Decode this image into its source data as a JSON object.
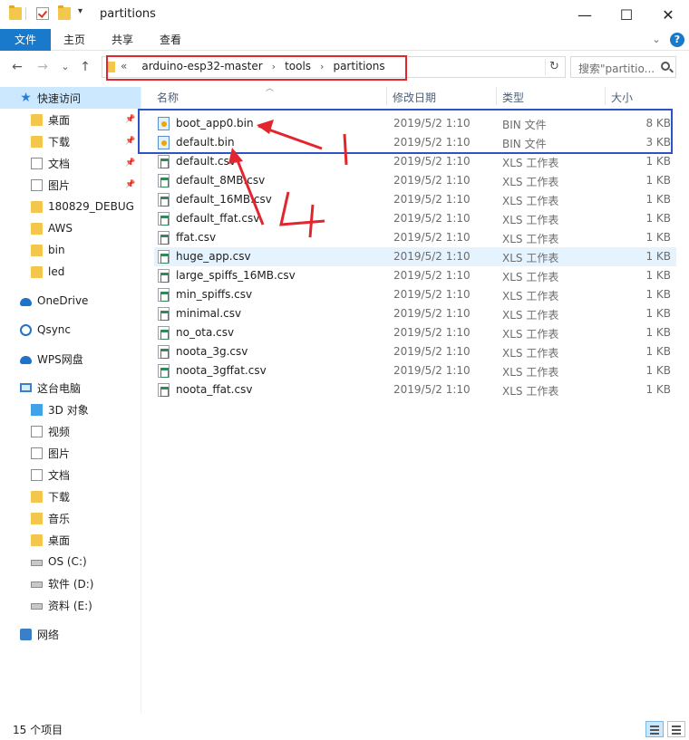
{
  "window": {
    "title": "partitions",
    "minimize": "—",
    "maximize": "☐",
    "close": "✕"
  },
  "ribbon": {
    "tabs": [
      "文件",
      "主页",
      "共享",
      "查看"
    ]
  },
  "nav": {
    "back": "←",
    "forward": "→",
    "recent": "⌄",
    "up": "↑",
    "breadcrumb_prefix": "«",
    "breadcrumbs": [
      "arduino-esp32-master",
      "tools",
      "partitions"
    ],
    "refresh": "↻",
    "search_placeholder": "搜索\"partitio..."
  },
  "sidebar": {
    "items": [
      {
        "label": "快速访问",
        "icon": "star-icon"
      },
      {
        "label": "桌面",
        "icon": "folder-icon",
        "pinned": true
      },
      {
        "label": "下载",
        "icon": "folder-icon",
        "pinned": true
      },
      {
        "label": "文档",
        "icon": "document-icon",
        "pinned": true
      },
      {
        "label": "图片",
        "icon": "picture-icon",
        "pinned": true
      },
      {
        "label": "180829_DEBUG",
        "icon": "folder-icon"
      },
      {
        "label": "AWS",
        "icon": "folder-icon"
      },
      {
        "label": "bin",
        "icon": "folder-icon"
      },
      {
        "label": "led",
        "icon": "folder-icon"
      },
      {
        "label": "OneDrive",
        "icon": "cloud-icon"
      },
      {
        "label": "Qsync",
        "icon": "sync-icon"
      },
      {
        "label": "WPS网盘",
        "icon": "cloud-icon"
      },
      {
        "label": "这台电脑",
        "icon": "pc-icon"
      },
      {
        "label": "3D 对象",
        "icon": "3d-objects-icon"
      },
      {
        "label": "视频",
        "icon": "video-icon"
      },
      {
        "label": "图片",
        "icon": "picture-icon"
      },
      {
        "label": "文档",
        "icon": "document-icon"
      },
      {
        "label": "下载",
        "icon": "download-icon"
      },
      {
        "label": "音乐",
        "icon": "music-icon"
      },
      {
        "label": "桌面",
        "icon": "folder-icon"
      },
      {
        "label": "OS (C:)",
        "icon": "drive-icon"
      },
      {
        "label": "软件 (D:)",
        "icon": "drive-icon"
      },
      {
        "label": "资料 (E:)",
        "icon": "drive-icon"
      },
      {
        "label": "网络",
        "icon": "network-icon"
      }
    ]
  },
  "columns": {
    "name": "名称",
    "date": "修改日期",
    "type": "类型",
    "size": "大小"
  },
  "files": [
    {
      "name": "boot_app0.bin",
      "date": "2019/5/2 1:10",
      "type": "BIN 文件",
      "size": "8 KB",
      "kind": "bin"
    },
    {
      "name": "default.bin",
      "date": "2019/5/2 1:10",
      "type": "BIN 文件",
      "size": "3 KB",
      "kind": "bin"
    },
    {
      "name": "default.csv",
      "date": "2019/5/2 1:10",
      "type": "XLS 工作表",
      "size": "1 KB",
      "kind": "csv"
    },
    {
      "name": "default_8MB.csv",
      "date": "2019/5/2 1:10",
      "type": "XLS 工作表",
      "size": "1 KB",
      "kind": "csv"
    },
    {
      "name": "default_16MB.csv",
      "date": "2019/5/2 1:10",
      "type": "XLS 工作表",
      "size": "1 KB",
      "kind": "csv"
    },
    {
      "name": "default_ffat.csv",
      "date": "2019/5/2 1:10",
      "type": "XLS 工作表",
      "size": "1 KB",
      "kind": "csv"
    },
    {
      "name": "ffat.csv",
      "date": "2019/5/2 1:10",
      "type": "XLS 工作表",
      "size": "1 KB",
      "kind": "csv"
    },
    {
      "name": "huge_app.csv",
      "date": "2019/5/2 1:10",
      "type": "XLS 工作表",
      "size": "1 KB",
      "kind": "csv"
    },
    {
      "name": "large_spiffs_16MB.csv",
      "date": "2019/5/2 1:10",
      "type": "XLS 工作表",
      "size": "1 KB",
      "kind": "csv"
    },
    {
      "name": "min_spiffs.csv",
      "date": "2019/5/2 1:10",
      "type": "XLS 工作表",
      "size": "1 KB",
      "kind": "csv"
    },
    {
      "name": "minimal.csv",
      "date": "2019/5/2 1:10",
      "type": "XLS 工作表",
      "size": "1 KB",
      "kind": "csv"
    },
    {
      "name": "no_ota.csv",
      "date": "2019/5/2 1:10",
      "type": "XLS 工作表",
      "size": "1 KB",
      "kind": "csv"
    },
    {
      "name": "noota_3g.csv",
      "date": "2019/5/2 1:10",
      "type": "XLS 工作表",
      "size": "1 KB",
      "kind": "csv"
    },
    {
      "name": "noota_3gffat.csv",
      "date": "2019/5/2 1:10",
      "type": "XLS 工作表",
      "size": "1 KB",
      "kind": "csv"
    },
    {
      "name": "noota_ffat.csv",
      "date": "2019/5/2 1:10",
      "type": "XLS 工作表",
      "size": "1 KB",
      "kind": "csv"
    }
  ],
  "status": {
    "item_count": "15 个项目"
  },
  "colors": {
    "accent": "#1979ca",
    "selection": "#cce8ff",
    "hover": "#e5f3ff",
    "annotation_red": "#e3262e",
    "annotation_blue": "#2e54c4"
  }
}
